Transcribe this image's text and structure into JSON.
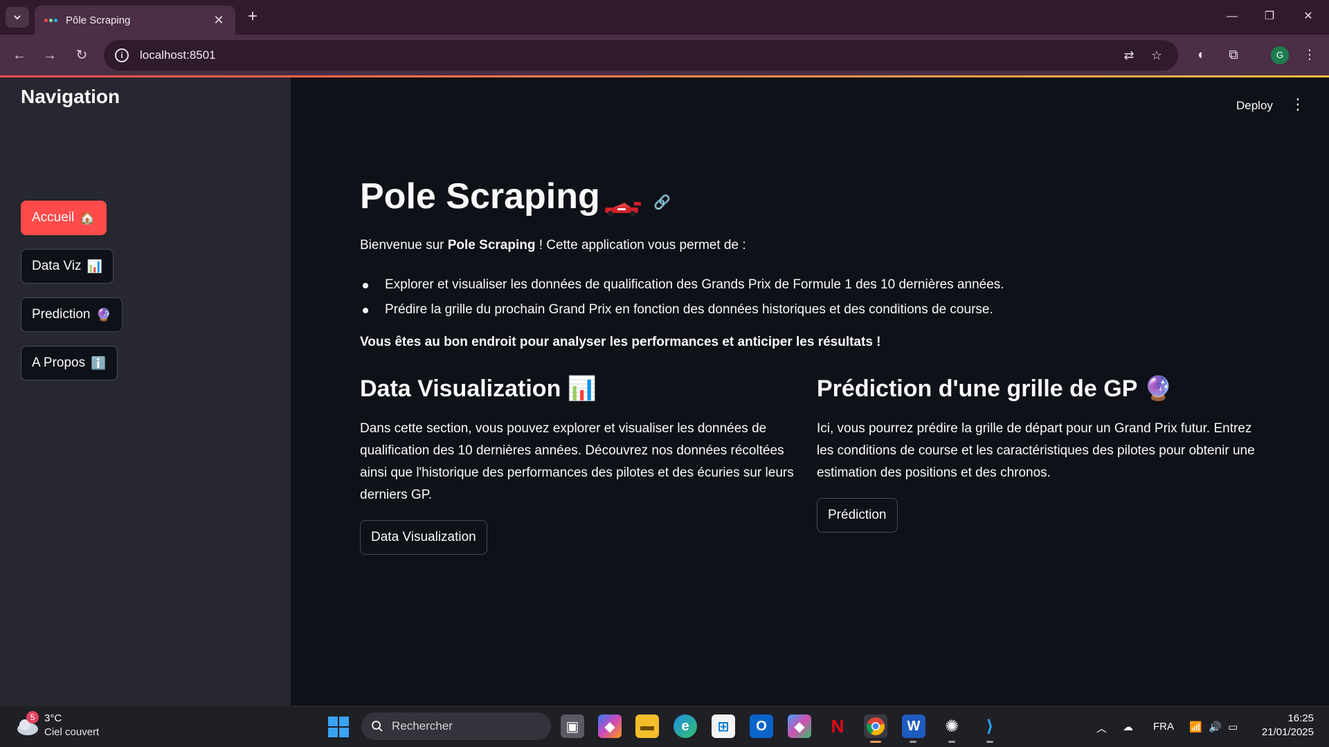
{
  "browser": {
    "tab_title": "Pôle Scraping",
    "url": "localhost:8501",
    "profile_initial": "G"
  },
  "app": {
    "deploy_label": "Deploy",
    "sidebar": {
      "title": "Navigation",
      "items": [
        {
          "label": "Accueil",
          "emoji": "🏠",
          "active": true
        },
        {
          "label": "Data Viz",
          "emoji": "📊",
          "active": false
        },
        {
          "label": "Prediction",
          "emoji": "🔮",
          "active": false
        },
        {
          "label": "A Propos",
          "emoji": "ℹ️",
          "active": false
        }
      ]
    },
    "main": {
      "title": "Pole Scraping",
      "intro_prefix": "Bienvenue sur ",
      "intro_bold": "Pole Scraping",
      "intro_suffix": " ! Cette application vous permet de :",
      "bullets": [
        "Explorer et visualiser les données de qualification des Grands Prix de Formule 1 des 10 dernières années.",
        "Prédire la grille du prochain Grand Prix en fonction des données historiques et des conditions de course."
      ],
      "bold_line": "Vous êtes au bon endroit pour analyser les performances et anticiper les résultats !",
      "left_col": {
        "heading": "Data Visualization",
        "emoji": "📊",
        "text": "Dans cette section, vous pouvez explorer et visualiser les données de qualification des 10 dernières années. Découvrez nos données récoltées ainsi que l'historique des performances des pilotes et des écuries sur leurs derniers GP.",
        "button": "Data Visualization"
      },
      "right_col": {
        "heading": "Prédiction d'une grille de GP",
        "emoji": "🔮",
        "text": "Ici, vous pourrez prédire la grille de départ pour un Grand Prix futur. Entrez les conditions de course et les caractéristiques des pilotes pour obtenir une estimation des positions et des chronos.",
        "button": "Prédiction"
      }
    }
  },
  "taskbar": {
    "weather_badge": "5",
    "temperature": "3°C",
    "weather_desc": "Ciel couvert",
    "search_placeholder": "Rechercher",
    "language": "FRA",
    "time": "16:25",
    "date": "21/01/2025"
  },
  "colors": {
    "accent": "#ff4b4b",
    "sidebar_bg": "#262730",
    "main_bg": "#0e1117",
    "browser_frame": "#2f1b2c"
  }
}
